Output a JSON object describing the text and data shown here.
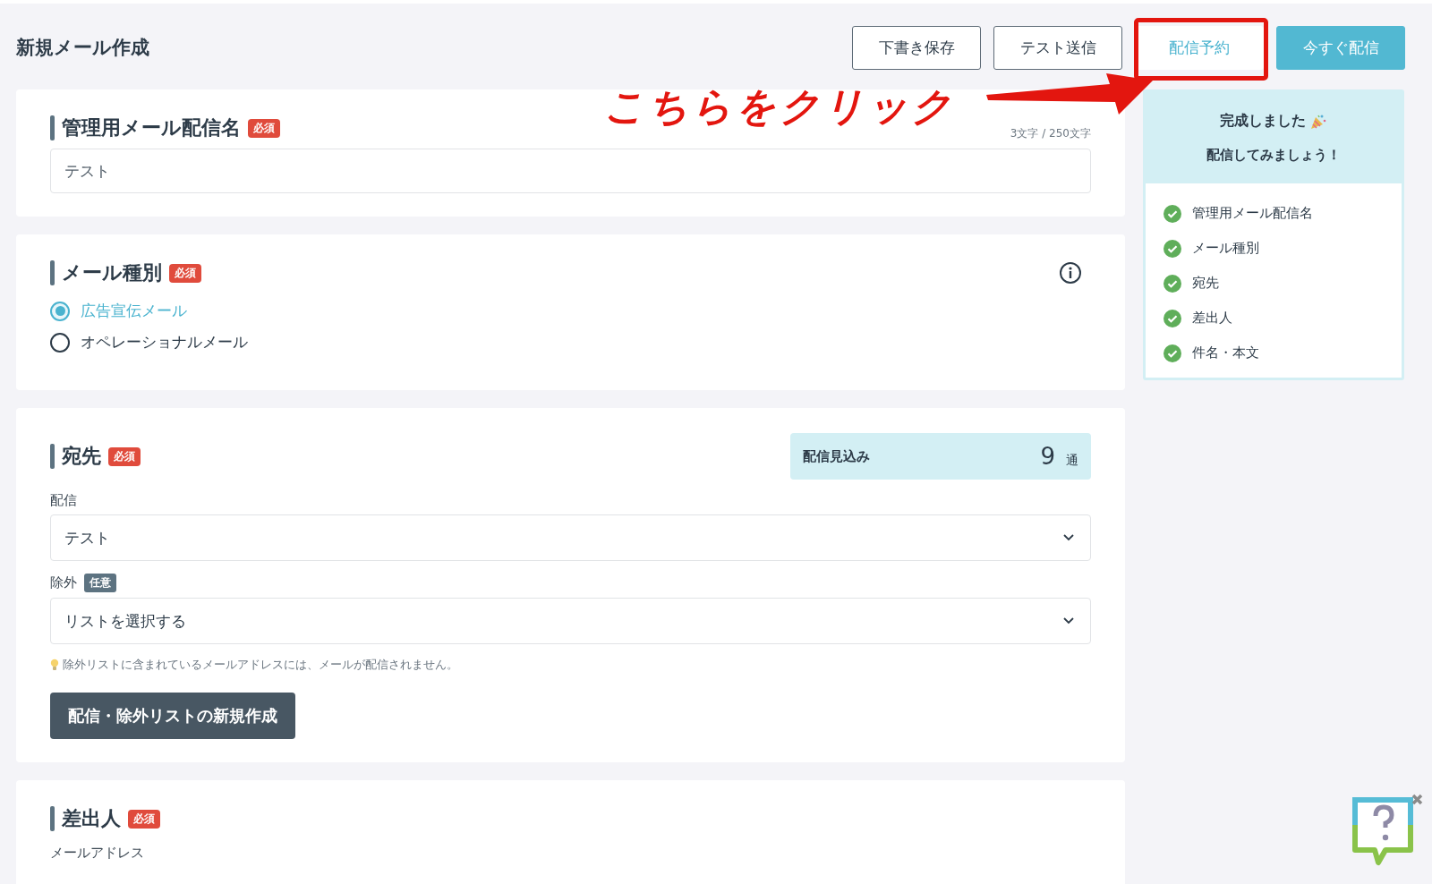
{
  "page_title": "新規メール作成",
  "header_buttons": [
    {
      "label": "下書き保存",
      "kind": "outline"
    },
    {
      "label": "テスト送信",
      "kind": "outline"
    },
    {
      "label": "配信予約",
      "kind": "outline-accent"
    },
    {
      "label": "今すぐ配信",
      "kind": "primary"
    }
  ],
  "annotation": {
    "text": "こちらをクリック"
  },
  "sections": [
    {
      "kind": "text_input",
      "title": "管理用メール配信名",
      "badge": "必須",
      "counter": "3文字 / 250文字",
      "value": "テスト"
    },
    {
      "kind": "radio",
      "title": "メール種別",
      "badge": "必須",
      "options": [
        {
          "label": "広告宣伝メール",
          "selected": true
        },
        {
          "label": "オペレーショナルメール",
          "selected": false
        }
      ]
    },
    {
      "kind": "recipients",
      "title": "宛先",
      "badge": "必須",
      "estimate": {
        "label": "配信見込み",
        "count": "9",
        "unit": "通"
      },
      "fields": [
        {
          "label": "配信",
          "value": "テスト"
        },
        {
          "label": "除外",
          "tag": "任意",
          "value": "リストを選択する"
        }
      ],
      "hint": "除外リストに含まれているメールアドレスには、メールが配信されません。",
      "button": "配信・除外リストの新規作成"
    },
    {
      "kind": "sender",
      "title": "差出人",
      "badge": "必須",
      "field_label": "メールアドレス"
    }
  ],
  "sidebar": {
    "title": "完成しました",
    "subtitle": "配信してみましょう！",
    "items": [
      {
        "label": "管理用メール配信名",
        "done": true
      },
      {
        "label": "メール種別",
        "done": true
      },
      {
        "label": "宛先",
        "done": true
      },
      {
        "label": "差出人",
        "done": true
      },
      {
        "label": "件名・本文",
        "done": true
      }
    ]
  }
}
